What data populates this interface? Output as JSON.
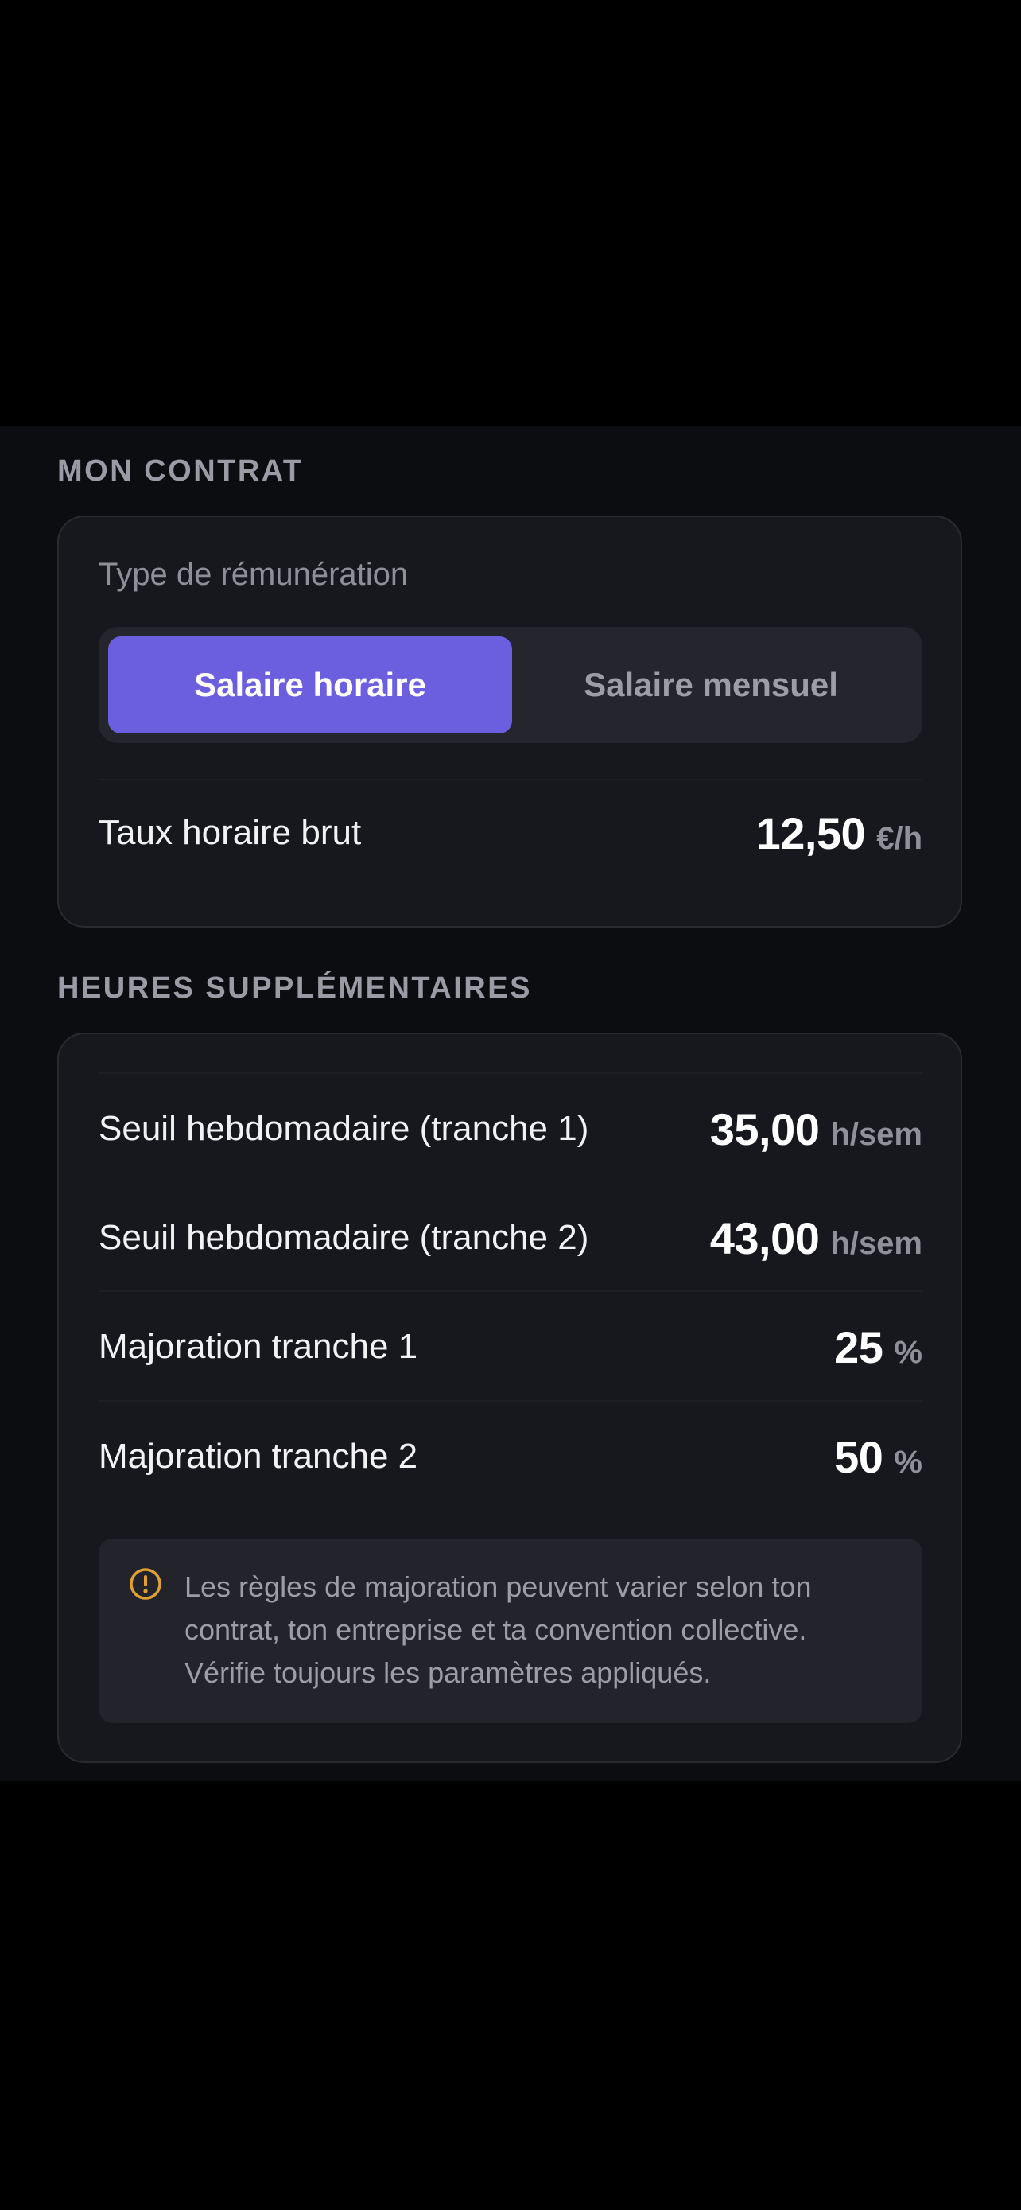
{
  "contract": {
    "section_title": "MON CONTRAT",
    "pay_type_label": "Type de rémunération",
    "pay_type_options": [
      "Salaire horaire",
      "Salaire mensuel"
    ],
    "pay_type_selected": "Salaire horaire",
    "hourly_rate": {
      "label": "Taux horaire brut",
      "value": "12,50",
      "unit": "€/h"
    }
  },
  "overtime": {
    "section_title": "HEURES SUPPLÉMENTAIRES",
    "rows": [
      {
        "label": "Seuil hebdomadaire (tranche 1)",
        "value": "35,00",
        "unit": "h/sem"
      },
      {
        "label": "Seuil hebdomadaire (tranche 2)",
        "value": "43,00",
        "unit": "h/sem"
      },
      {
        "label": "Majoration tranche 1",
        "value": "25",
        "unit": "%"
      },
      {
        "label": "Majoration tranche 2",
        "value": "50",
        "unit": "%"
      }
    ],
    "notice": {
      "icon": "warning-circle-icon",
      "text": "Les règles de majoration peuvent varier selon ton contrat, ton entreprise et ta convention collective. Vérifie toujours les paramètres appliqués."
    }
  },
  "colors": {
    "accent": "#6b5fe0",
    "background": "#0c0d11",
    "card": "#17181d",
    "warning": "#e0a034"
  }
}
